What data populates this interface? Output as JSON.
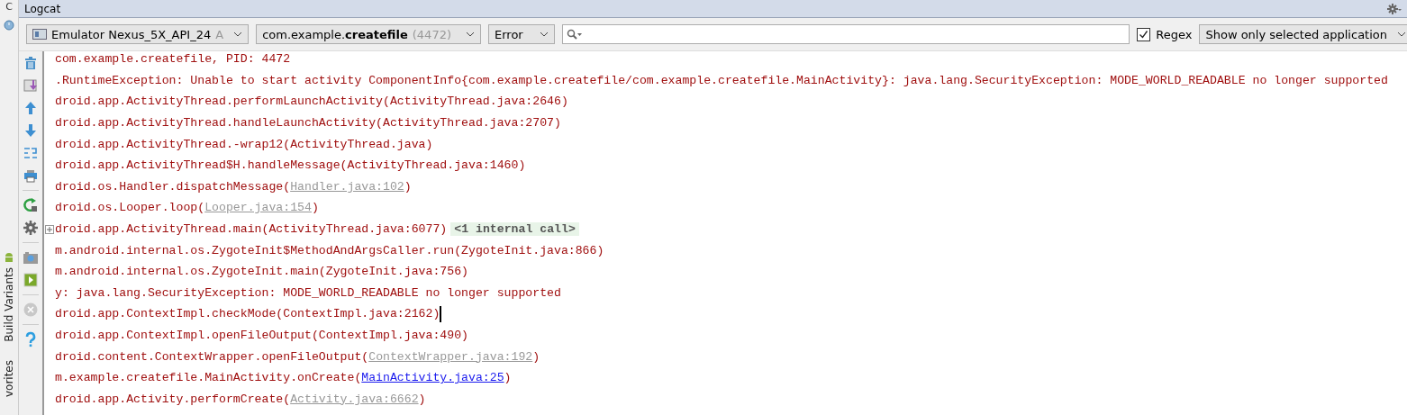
{
  "side_strip": {
    "top_label": "C",
    "tool_windows": [
      {
        "label": "Build Variants"
      },
      {
        "label": "vorites"
      }
    ]
  },
  "window": {
    "title": "Logcat"
  },
  "filters": {
    "device": {
      "value": "Emulator Nexus_5X_API_24",
      "suffix": "A"
    },
    "process": {
      "prefix": "com.example.",
      "bold": "createfile",
      "pid": "(4472)"
    },
    "level": {
      "value": "Error"
    },
    "regex": {
      "label": "Regex",
      "checked": true
    },
    "scope": {
      "value": "Show only selected application"
    }
  },
  "log_lines": [
    {
      "parts": [
        {
          "text": "com.example.createfile, PID: 4472",
          "kind": "plain"
        }
      ]
    },
    {
      "parts": [
        {
          "text": ".RuntimeException: Unable to start activity ComponentInfo{com.example.createfile/com.example.createfile.MainActivity}: java.lang.SecurityException: MODE_WORLD_READABLE no longer supported",
          "kind": "plain"
        }
      ]
    },
    {
      "parts": [
        {
          "text": "droid.app.ActivityThread.performLaunchActivity(ActivityThread.java:2646)",
          "kind": "plain"
        }
      ]
    },
    {
      "parts": [
        {
          "text": "droid.app.ActivityThread.handleLaunchActivity(ActivityThread.java:2707)",
          "kind": "plain"
        }
      ]
    },
    {
      "parts": [
        {
          "text": "droid.app.ActivityThread.-wrap12(ActivityThread.java)",
          "kind": "plain"
        }
      ]
    },
    {
      "parts": [
        {
          "text": "droid.app.ActivityThread$H.handleMessage(ActivityThread.java:1460)",
          "kind": "plain"
        }
      ]
    },
    {
      "parts": [
        {
          "text": "droid.os.Handler.dispatchMessage(",
          "kind": "plain"
        },
        {
          "text": "Handler.java:102",
          "kind": "library-link"
        },
        {
          "text": ")",
          "kind": "plain"
        }
      ]
    },
    {
      "parts": [
        {
          "text": "droid.os.Looper.loop(",
          "kind": "plain"
        },
        {
          "text": "Looper.java:154",
          "kind": "library-link"
        },
        {
          "text": ")",
          "kind": "plain"
        }
      ]
    },
    {
      "parts": [
        {
          "text": "droid.app.ActivityThread.main(ActivityThread.java:6077)",
          "kind": "plain"
        }
      ],
      "folded": "<1 internal call>"
    },
    {
      "parts": [
        {
          "text": "m.android.internal.os.ZygoteInit$MethodAndArgsCaller.run(ZygoteInit.java:866)",
          "kind": "plain"
        }
      ]
    },
    {
      "parts": [
        {
          "text": "m.android.internal.os.ZygoteInit.main(ZygoteInit.java:756)",
          "kind": "plain"
        }
      ]
    },
    {
      "parts": [
        {
          "text": "y: java.lang.SecurityException: MODE_WORLD_READABLE no longer supported",
          "kind": "plain"
        }
      ]
    },
    {
      "parts": [
        {
          "text": "droid.app.ContextImpl.checkMode(ContextImpl.java:2162)",
          "kind": "plain"
        }
      ],
      "cursor": true
    },
    {
      "parts": [
        {
          "text": "droid.app.ContextImpl.openFileOutput(ContextImpl.java:490)",
          "kind": "plain"
        }
      ]
    },
    {
      "parts": [
        {
          "text": "droid.content.ContextWrapper.openFileOutput(",
          "kind": "plain"
        },
        {
          "text": "ContextWrapper.java:192",
          "kind": "library-link"
        },
        {
          "text": ")",
          "kind": "plain"
        }
      ]
    },
    {
      "parts": [
        {
          "text": "m.example.createfile.MainActivity.onCreate(",
          "kind": "plain"
        },
        {
          "text": "MainActivity.java:25",
          "kind": "source-link"
        },
        {
          "text": ")",
          "kind": "plain"
        }
      ]
    },
    {
      "parts": [
        {
          "text": "droid.app.Activity.performCreate(",
          "kind": "plain"
        },
        {
          "text": "Activity.java:6662",
          "kind": "library-link"
        },
        {
          "text": ")",
          "kind": "plain"
        }
      ]
    }
  ]
}
